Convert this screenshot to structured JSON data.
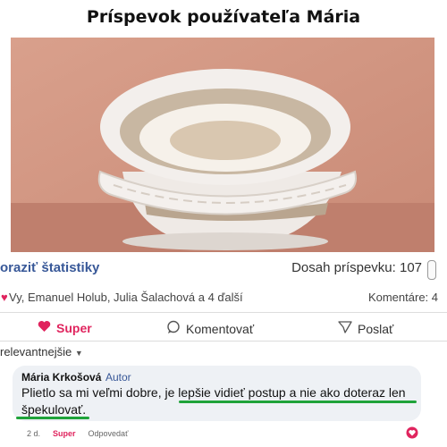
{
  "header": {
    "title": "Príspevok používateľa Mária"
  },
  "post": {
    "stats_link": "oraziť štatistiky",
    "reach": "Dosah príspevku: 107",
    "reactions_names": "Vy, Emanuel Holub, Julia Šalachová a 4 ďalší",
    "comments_count": "Komentáre: 4"
  },
  "actions": {
    "like_label": "Super",
    "comment_label": "Komentovať",
    "share_label": "Poslať"
  },
  "sort": {
    "label": "relevantnejšie"
  },
  "comment": {
    "author": "Mária Krkošová",
    "badge": "Autor",
    "text_line1": "Plietlo sa mi veľmi dobre, je lepšie vidieť postup a nie ako doteraz len",
    "text_line2": "špekulovať.",
    "time": "2 d.",
    "reaction_label": "Super",
    "reply_label": "Odpovedať"
  },
  "colors": {
    "accent": "#385898",
    "like": "#e0245e",
    "highlight": "#1fa33a"
  }
}
